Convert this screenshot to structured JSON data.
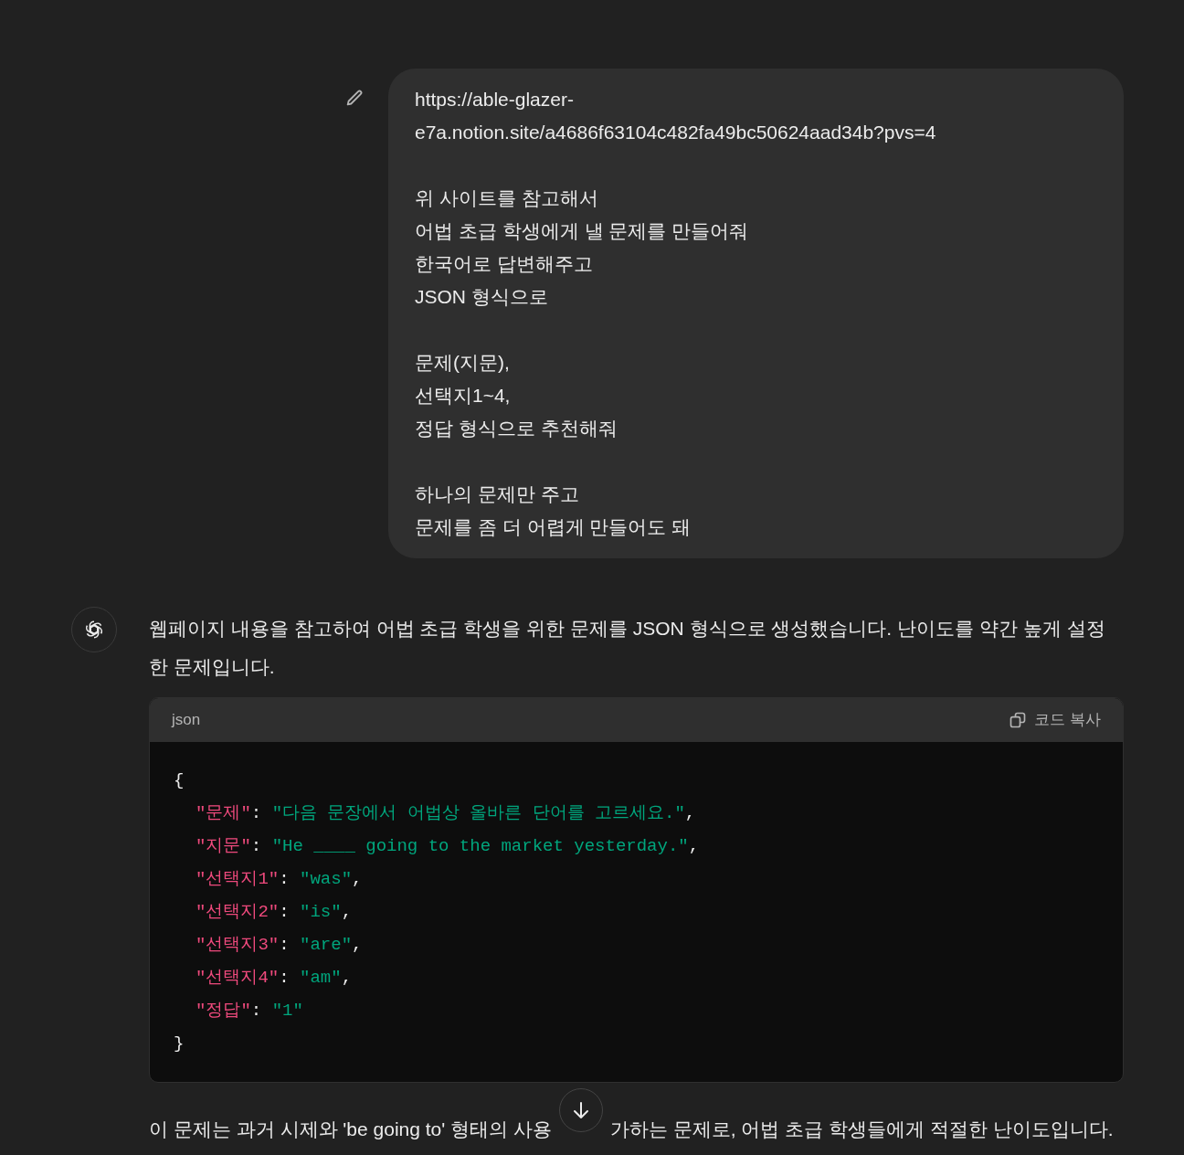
{
  "user_message": {
    "paragraphs": [
      [
        "https://able-glazer-",
        "e7a.notion.site/a4686f63104c482fa49bc50624aad34b?pvs=4"
      ],
      [
        "위 사이트를 참고해서",
        "어법 초급 학생에게 낼 문제를 만들어줘",
        "한국어로 답변해주고",
        "JSON 형식으로"
      ],
      [
        "문제(지문),",
        "선택지1~4,",
        "정답 형식으로 추천해줘"
      ],
      [
        "하나의 문제만 주고",
        "문제를 좀 더 어렵게 만들어도 돼"
      ]
    ]
  },
  "assistant_message": {
    "intro": "웹페이지 내용을 참고하여 어법 초급 학생을 위한 문제를 JSON 형식으로 생성했습니다. 난이도를 약간 높게 설정한 문제입니다.",
    "code_block": {
      "language": "json",
      "copy_label": "코드 복사",
      "lines": [
        {
          "kind": "brace",
          "text": "{"
        },
        {
          "kind": "pair",
          "key": "\"문제\"",
          "sep": ": ",
          "value": "\"다음 문장에서 어법상 올바른 단어를 고르세요.\"",
          "end": ","
        },
        {
          "kind": "pair",
          "key": "\"지문\"",
          "sep": ": ",
          "value": "\"He ____ going to the market yesterday.\"",
          "end": ","
        },
        {
          "kind": "pair",
          "key": "\"선택지1\"",
          "sep": ": ",
          "value": "\"was\"",
          "end": ","
        },
        {
          "kind": "pair",
          "key": "\"선택지2\"",
          "sep": ": ",
          "value": "\"is\"",
          "end": ","
        },
        {
          "kind": "pair",
          "key": "\"선택지3\"",
          "sep": ": ",
          "value": "\"are\"",
          "end": ","
        },
        {
          "kind": "pair",
          "key": "\"선택지4\"",
          "sep": ": ",
          "value": "\"am\"",
          "end": ","
        },
        {
          "kind": "pair",
          "key": "\"정답\"",
          "sep": ": ",
          "value": "\"1\""
        },
        {
          "kind": "brace",
          "text": "}"
        }
      ]
    },
    "outro_before": "이 문제는 과거 시제와 'be going to' 형태의 사용",
    "outro_after": "가하는 문제로, 어법 초급 학생들에게 적절한 난이도입니다."
  }
}
